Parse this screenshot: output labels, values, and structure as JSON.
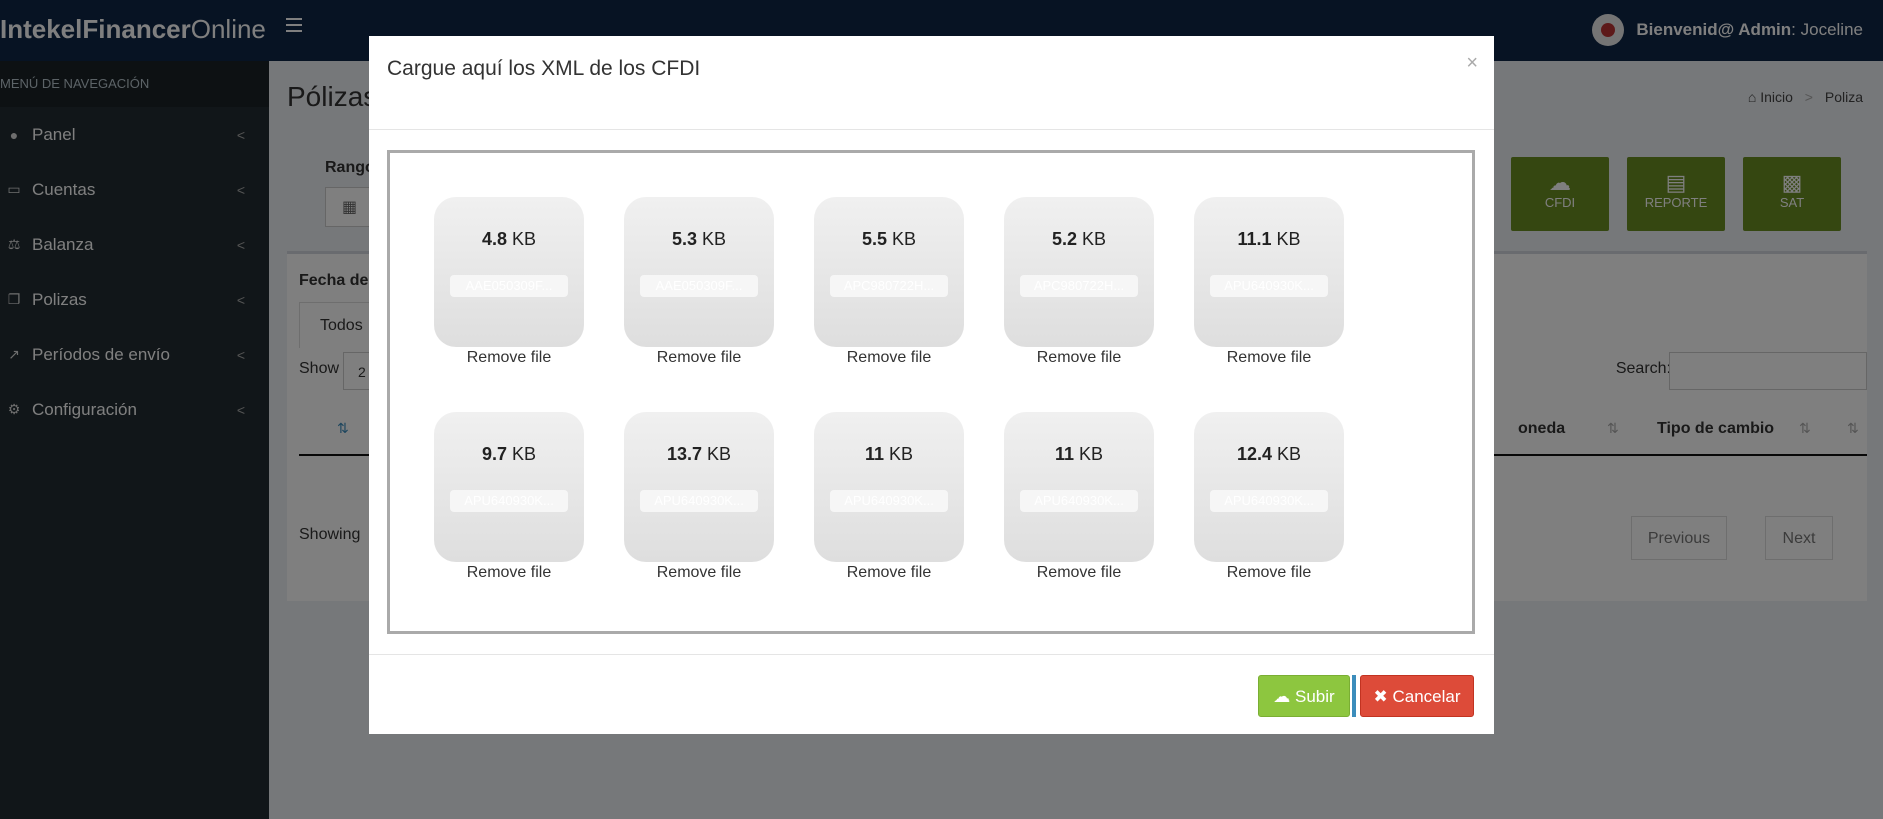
{
  "app": {
    "brand_bold": "IntekelFinancer",
    "brand_light": "Online",
    "user_greeting": "Bienvenid@ Admin",
    "user_name": ": Joceline"
  },
  "sidebar": {
    "header": "MENÚ DE NAVEGACIÓN",
    "items": [
      {
        "label": "Panel",
        "icon": "user-icon"
      },
      {
        "label": "Cuentas",
        "icon": "laptop-icon"
      },
      {
        "label": "Balanza",
        "icon": "balance-scale-icon"
      },
      {
        "label": "Polizas",
        "icon": "copy-icon"
      },
      {
        "label": "Períodos de envío",
        "icon": "line-chart-icon"
      },
      {
        "label": "Configuración",
        "icon": "gears-icon"
      }
    ]
  },
  "page": {
    "title": "Pólizas",
    "breadcrumb": {
      "home": "Inicio",
      "current": "Poliza"
    },
    "filter_label": "Rango",
    "actions": [
      {
        "label": "CFDI",
        "icon": "cloud-upload-icon"
      },
      {
        "label": "REPORTE",
        "icon": "file-text-icon"
      },
      {
        "label": "SAT",
        "icon": "qrcode-icon"
      }
    ],
    "table": {
      "section_label": "Fecha de",
      "tab": "Todos",
      "show_label": "Show",
      "show_value": "2",
      "search_label": "Search:",
      "columns": [
        "oneda",
        "Tipo de cambio"
      ],
      "showing": "Showing",
      "prev": "Previous",
      "next": "Next"
    }
  },
  "modal": {
    "title": "Cargue aquí los XML de los CFDI",
    "close": "×",
    "files": [
      {
        "size": "4.8",
        "unit": "KB",
        "name": "AAE050309F...",
        "remove": "Remove file"
      },
      {
        "size": "5.3",
        "unit": "KB",
        "name": "AAE050309F...",
        "remove": "Remove file"
      },
      {
        "size": "5.5",
        "unit": "KB",
        "name": "APC980722H...",
        "remove": "Remove file"
      },
      {
        "size": "5.2",
        "unit": "KB",
        "name": "APC980722H...",
        "remove": "Remove file"
      },
      {
        "size": "11.1",
        "unit": "KB",
        "name": "APU640930K...",
        "remove": "Remove file"
      },
      {
        "size": "9.7",
        "unit": "KB",
        "name": "APU640930K...",
        "remove": "Remove file"
      },
      {
        "size": "13.7",
        "unit": "KB",
        "name": "APU640930K...",
        "remove": "Remove file"
      },
      {
        "size": "11",
        "unit": "KB",
        "name": "APU640930K...",
        "remove": "Remove file"
      },
      {
        "size": "11",
        "unit": "KB",
        "name": "APU640930K...",
        "remove": "Remove file"
      },
      {
        "size": "12.4",
        "unit": "KB",
        "name": "APU640930K...",
        "remove": "Remove file"
      }
    ],
    "submit": "Subir",
    "cancel": "Cancelar"
  },
  "colors": {
    "navbar": "#0f2747",
    "sidebar": "#222d32",
    "action_green": "#6b8e23",
    "submit_green": "#8dc63f",
    "cancel_red": "#dd4b39"
  }
}
